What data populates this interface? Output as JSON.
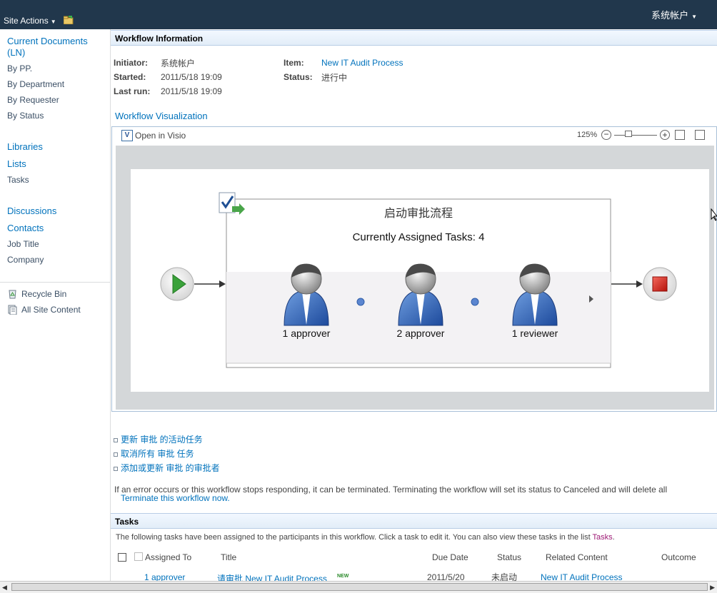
{
  "topbar": {
    "site_actions_label": "Site Actions",
    "user_name": "系统帐户"
  },
  "leftnav": {
    "current_documents": "Current Documents (LN)",
    "views": [
      "By PP.",
      "By Department",
      "By Requester",
      "By Status"
    ],
    "libraries": "Libraries",
    "lists": "Lists",
    "tasks": "Tasks",
    "discussions": "Discussions",
    "contacts": "Contacts",
    "job_title": "Job Title",
    "company": "Company",
    "recycle_bin": "Recycle Bin",
    "all_site_content": "All Site Content"
  },
  "workflow_info": {
    "header": "Workflow Information",
    "initiator_label": "Initiator:",
    "initiator_value": "系统帐户",
    "started_label": "Started:",
    "started_value": "2011/5/18 19:09",
    "lastrun_label": "Last run:",
    "lastrun_value": "2011/5/18 19:09",
    "item_label": "Item:",
    "item_value": "New IT Audit Process",
    "status_label": "Status:",
    "status_value": "进行中"
  },
  "visualization": {
    "title": "Workflow Visualization",
    "open_in_visio": "Open in Visio",
    "zoom_level": "125%",
    "stage_title": "启动审批流程",
    "assigned_text": "Currently Assigned Tasks: 4",
    "participants": [
      "1 approver",
      "2 approver",
      "1 reviewer"
    ]
  },
  "actions": {
    "links": [
      "更新 审批 的活动任务",
      "取消所有 审批 任务",
      "添加或更新 审批 的审批者"
    ],
    "error_text": "If an error occurs or this workflow stops responding, it can be terminated. Terminating the workflow will set its status to Canceled and will delete all",
    "terminate_link": "Terminate this workflow now."
  },
  "tasks": {
    "header": "Tasks",
    "description_prefix": "The following tasks have been assigned to the participants in this workflow. Click a task to edit it. You can also view these tasks in the list ",
    "description_link": "Tasks",
    "description_suffix": ".",
    "columns": {
      "assigned_to": "Assigned To",
      "title": "Title",
      "due_date": "Due Date",
      "status": "Status",
      "related_content": "Related Content",
      "outcome": "Outcome"
    },
    "rows": [
      {
        "assigned_to": "1 approver",
        "title": "请审批 New IT Audit Process",
        "new_badge": "NEW",
        "due_date": "2011/5/20",
        "status": "未启动",
        "related_content": "New IT Audit Process"
      }
    ]
  }
}
